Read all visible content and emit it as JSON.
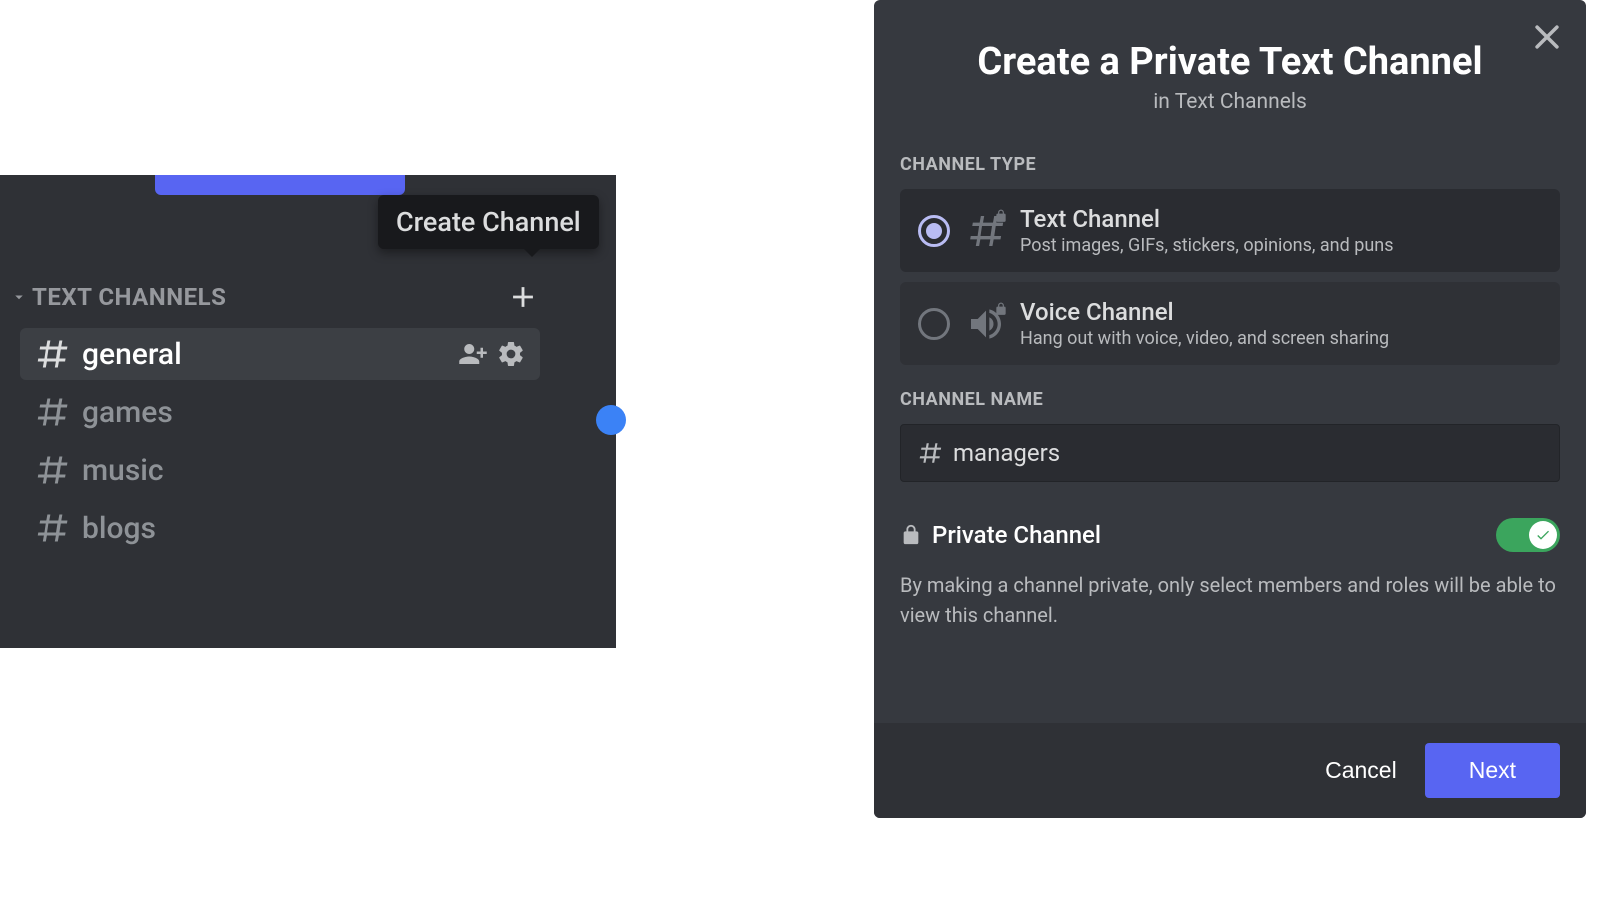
{
  "sidebar": {
    "tooltip": "Create Channel",
    "category_label": "TEXT CHANNELS",
    "channels": [
      {
        "name": "general",
        "selected": true
      },
      {
        "name": "games",
        "selected": false
      },
      {
        "name": "music",
        "selected": false
      },
      {
        "name": "blogs",
        "selected": false
      }
    ]
  },
  "modal": {
    "title": "Create a Private Text Channel",
    "subtitle": "in Text Channels",
    "section_type": "CHANNEL TYPE",
    "types": [
      {
        "title": "Text Channel",
        "desc": "Post images, GIFs, stickers, opinions, and puns",
        "selected": true
      },
      {
        "title": "Voice Channel",
        "desc": "Hang out with voice, video, and screen sharing",
        "selected": false
      }
    ],
    "section_name": "CHANNEL NAME",
    "name_value": "managers",
    "private_label": "Private Channel",
    "private_desc": "By making a channel private, only select members and roles will be able to view this channel.",
    "private_enabled": true,
    "cancel_label": "Cancel",
    "next_label": "Next"
  }
}
